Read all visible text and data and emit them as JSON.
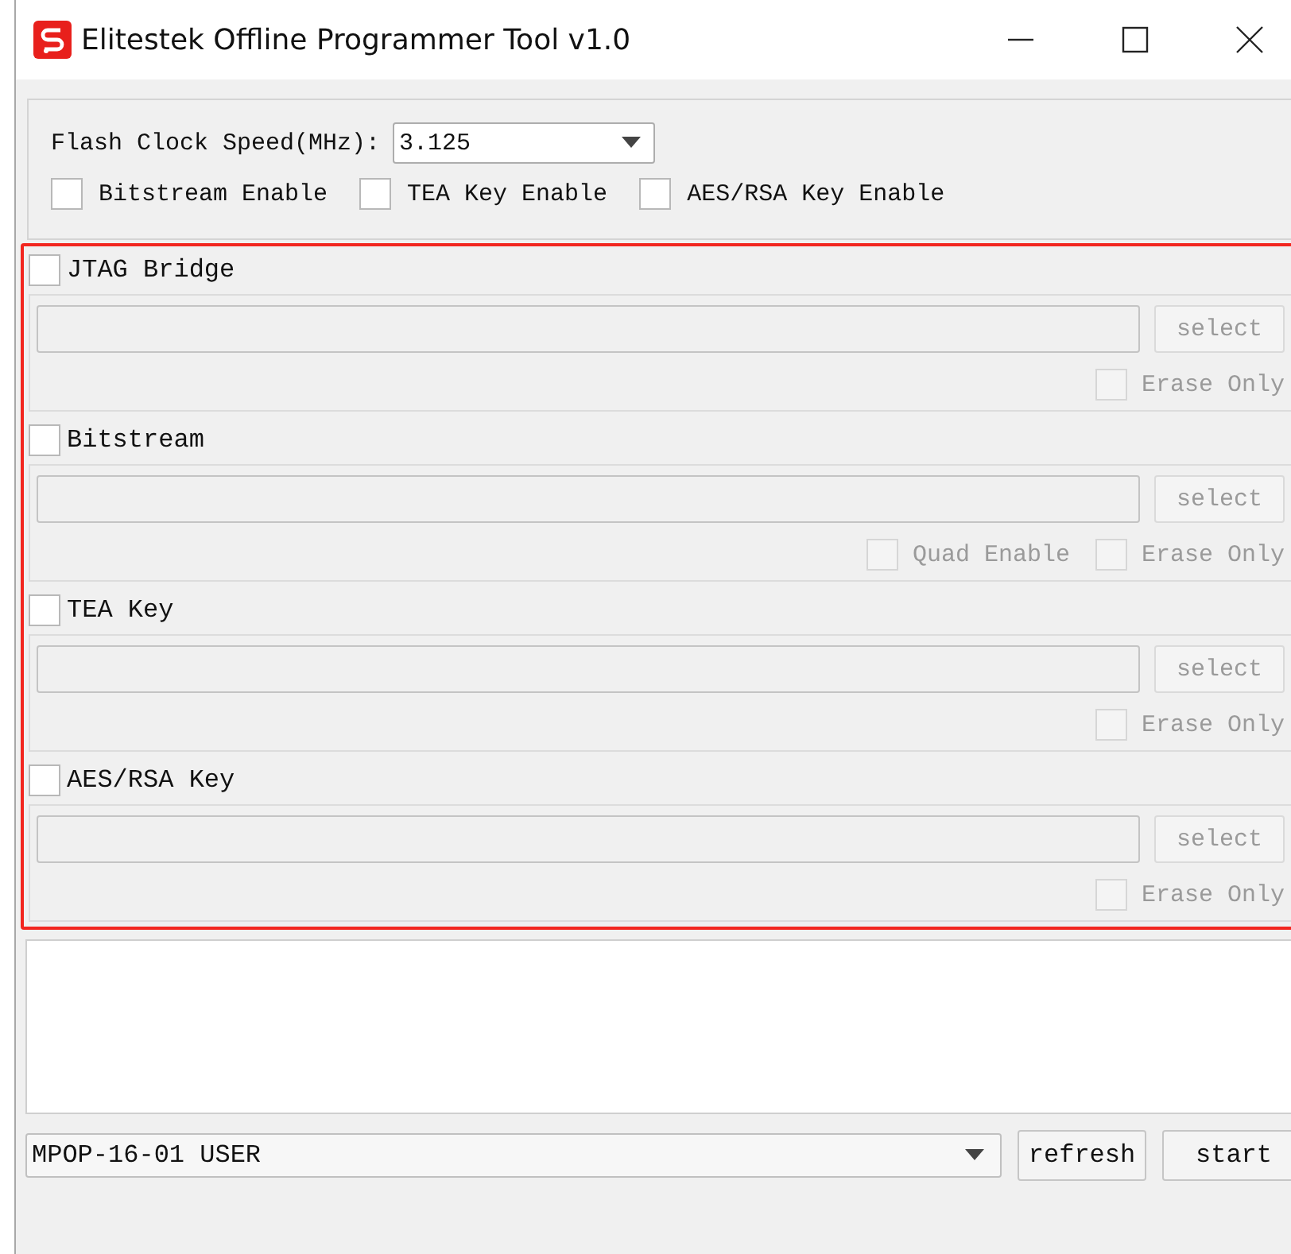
{
  "window": {
    "title": "Elitestek Offline Programmer Tool v1.0"
  },
  "settings": {
    "flash_clock_label": "Flash Clock Speed(MHz):",
    "flash_clock_value": "3.125",
    "enables": [
      {
        "label": "Bitstream Enable",
        "checked": false
      },
      {
        "label": "TEA Key Enable",
        "checked": false
      },
      {
        "label": "AES/RSA Key Enable",
        "checked": false
      }
    ]
  },
  "sections": [
    {
      "title": "JTAG Bridge",
      "checked": false,
      "select_button": {
        "label": "select",
        "disabled": true
      },
      "options": [
        {
          "label": "Erase Only",
          "checked": false,
          "disabled": true
        }
      ]
    },
    {
      "title": "Bitstream",
      "checked": false,
      "select_button": {
        "label": "select",
        "disabled": true
      },
      "options": [
        {
          "label": "Quad Enable",
          "checked": false,
          "disabled": true
        },
        {
          "label": "Erase Only",
          "checked": false,
          "disabled": true
        }
      ]
    },
    {
      "title": "TEA Key",
      "checked": false,
      "select_button": {
        "label": "select",
        "disabled": true
      },
      "options": [
        {
          "label": "Erase Only",
          "checked": false,
          "disabled": true
        }
      ]
    },
    {
      "title": "AES/RSA Key",
      "checked": false,
      "select_button": {
        "label": "select",
        "disabled": true
      },
      "options": [
        {
          "label": "Erase Only",
          "checked": false,
          "disabled": true
        }
      ]
    }
  ],
  "footer": {
    "device": "MPOP-16-01 USER",
    "buttons": [
      {
        "label": "refresh"
      },
      {
        "label": "start"
      }
    ]
  }
}
